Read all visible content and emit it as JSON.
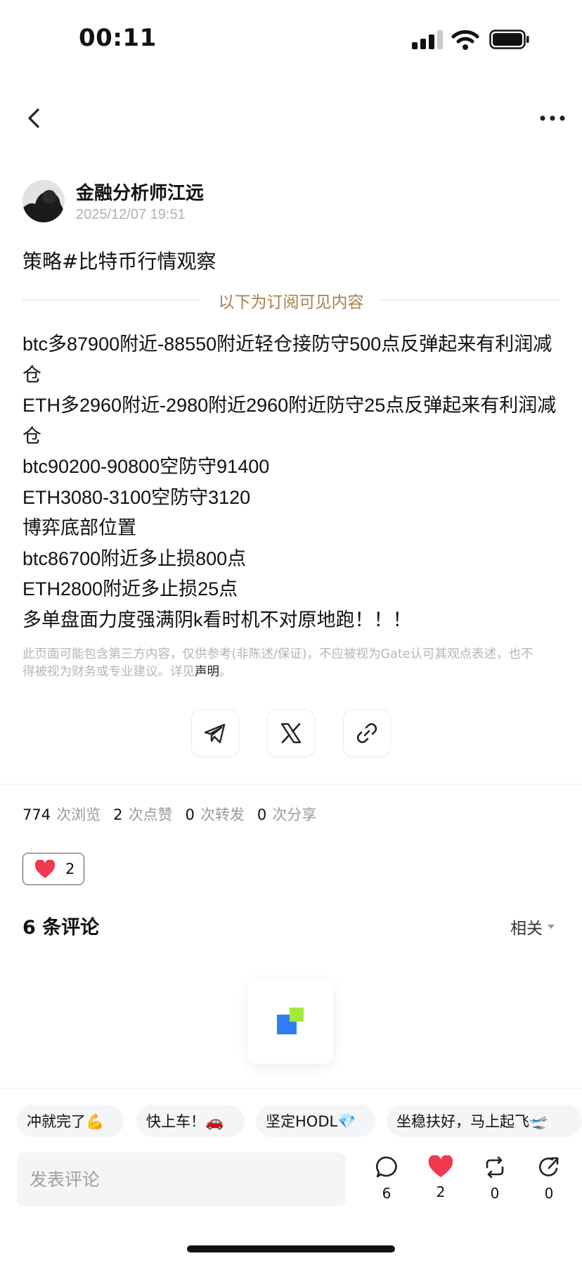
{
  "status_bar": {
    "time": "00:11"
  },
  "author": {
    "name": "金融分析师江远",
    "date": "2025/12/07 19:51"
  },
  "post": {
    "title": "策略#比特币行情观察",
    "subscriber_divider": "以下为订阅可见内容",
    "lines": [
      "btc多87900附近-88550附近轻仓接防守500点反弹起来有利润减仓",
      "ETH多2960附近-2980附近2960附近防守25点反弹起来有利润减仓",
      "btc90200-90800空防守91400",
      "ETH3080-3100空防守3120",
      "博弈底部位置",
      "btc86700附近多止损800点",
      "ETH2800附近多止损25点",
      "多单盘面力度强满阴k看时机不对原地跑！！！"
    ],
    "disclaimer": "此页面可能包含第三方内容，仅供参考(非陈述/保证)，不应被视为Gate认可其观点表述，也不得被视为财务或专业建议。详见",
    "disclaimer_link": "声明",
    "disclaimer_end": "。"
  },
  "share": {
    "icons": [
      "telegram-icon",
      "x-icon",
      "link-icon"
    ]
  },
  "stats": {
    "views": "774",
    "views_label": "次浏览",
    "likes": "2",
    "likes_label": "次点赞",
    "reposts": "0",
    "reposts_label": "次转发",
    "shares": "0",
    "shares_label": "次分享"
  },
  "reaction": {
    "count": "2"
  },
  "comments": {
    "title": "6 条评论",
    "sort_label": "相关"
  },
  "quick_replies": [
    "冲就完了💪",
    "快上车！🚗",
    "坚定HODL💎",
    "坐稳扶好，马上起飞🛫"
  ],
  "comment_input": {
    "placeholder": "发表评论"
  },
  "actions": {
    "comments": "6",
    "likes": "2",
    "reposts": "0",
    "shares": "0"
  },
  "colors": {
    "accent_gold": "#a5814a",
    "heart_red": "#f0384e",
    "loader_blue": "#2f7df6",
    "loader_green": "#a4e83c"
  }
}
